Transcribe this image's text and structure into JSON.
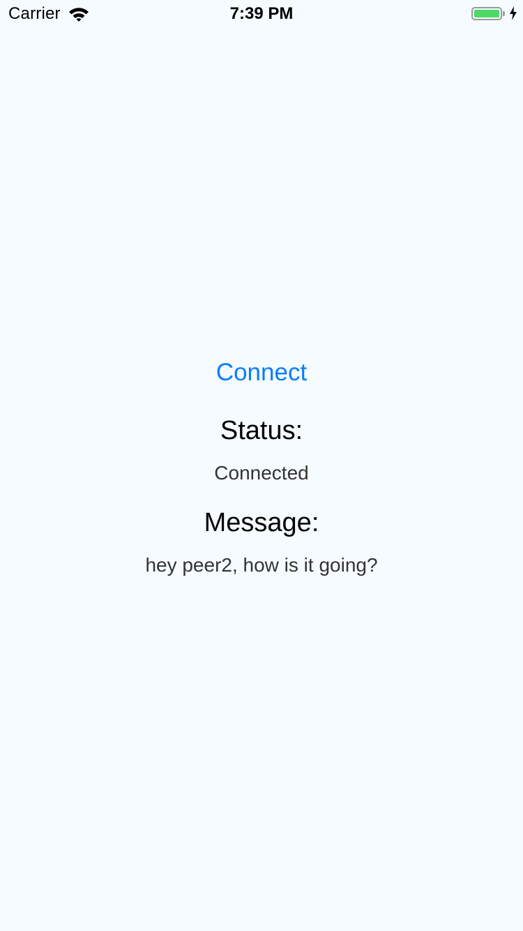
{
  "status_bar": {
    "carrier": "Carrier",
    "time": "7:39 PM",
    "battery_level": 1.0,
    "charging": true,
    "icons": {
      "wifi": "wifi-icon",
      "battery": "battery-icon",
      "charging": "charging-bolt-icon"
    }
  },
  "main": {
    "connect_label": "Connect",
    "status_label": "Status:",
    "status_value": "Connected",
    "message_label": "Message:",
    "message_value": "hey peer2, how is it going?"
  },
  "colors": {
    "background": "#f5fbff",
    "accent": "#0a7cff",
    "battery": "#4cd964"
  }
}
